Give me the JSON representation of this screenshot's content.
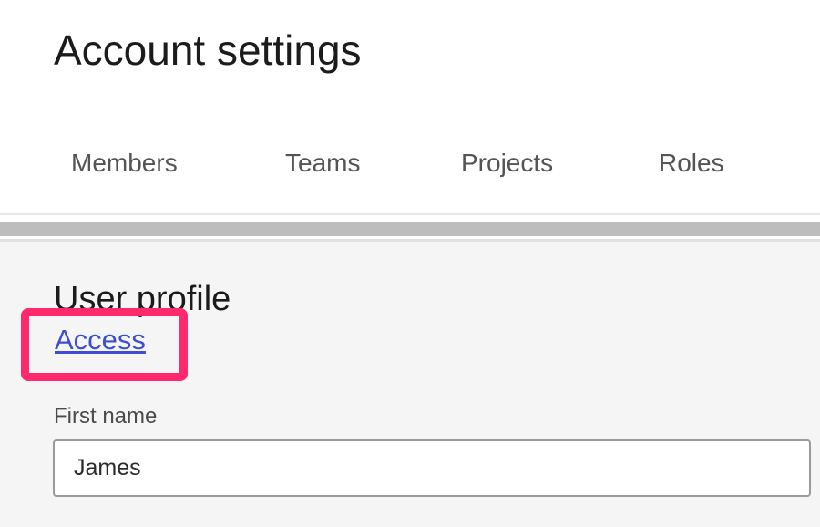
{
  "header": {
    "title": "Account settings"
  },
  "tabs": [
    {
      "label": "Members"
    },
    {
      "label": "Teams"
    },
    {
      "label": "Projects"
    },
    {
      "label": "Roles"
    }
  ],
  "profile": {
    "section_title": "User profile",
    "access_link": "Access",
    "first_name_label": "First name",
    "first_name_value": "James"
  },
  "colors": {
    "link": "#3d4fd0",
    "highlight": "#ff2a6d",
    "content_background": "#f5f5f5"
  }
}
